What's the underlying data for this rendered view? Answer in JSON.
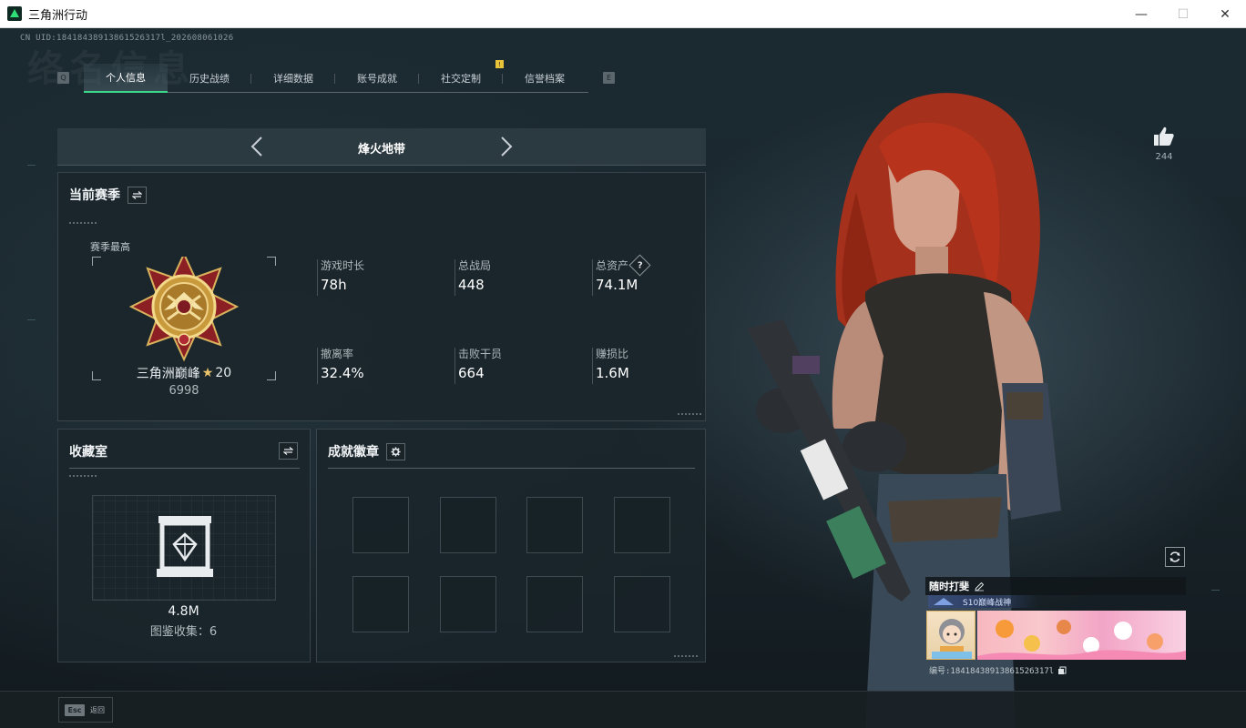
{
  "window": {
    "title": "三角洲行动",
    "minimize": "—",
    "maximize": "☐",
    "close": "✕"
  },
  "header": {
    "uid_line": "CN UID:18418438913861526317l_202608061026",
    "watermark": "络名信息"
  },
  "tabs": {
    "left_key": "Q",
    "right_key": "E",
    "items": [
      {
        "label": "个人信息",
        "active": true
      },
      {
        "label": "历史战绩"
      },
      {
        "label": "详细数据"
      },
      {
        "label": "账号成就"
      },
      {
        "label": "社交定制"
      },
      {
        "label": "信誉档案"
      }
    ],
    "badge": "!"
  },
  "mode": {
    "title": "烽火地带"
  },
  "season": {
    "title": "当前赛季",
    "best_label": "赛季最高",
    "rank_name": "三角洲巅峰",
    "rank_star": "★",
    "rank_level": "20",
    "rank_score": "6998",
    "stats": [
      {
        "label": "游戏时长",
        "value": "78h"
      },
      {
        "label": "总战局",
        "value": "448"
      },
      {
        "label": "总资产",
        "value": "74.1M",
        "help": "?"
      },
      {
        "label": "撤离率",
        "value": "32.4%"
      },
      {
        "label": "击败干员",
        "value": "664"
      },
      {
        "label": "赚损比",
        "value": "1.6M"
      }
    ]
  },
  "collection": {
    "title": "收藏室",
    "value": "4.8M",
    "sub": "图鉴收集：6"
  },
  "achievements": {
    "title": "成就徽章",
    "slot_count": 8
  },
  "like": {
    "count": "244"
  },
  "card": {
    "name": "随时打斐",
    "title_text": "S10巅峰战神",
    "id_line": "编号:18418438913861526317l"
  },
  "bottom": {
    "esc_key": "Esc",
    "esc_label": "返回"
  },
  "colors": {
    "accent": "#39d98a",
    "badge": "#e8c33a",
    "hair": "#b8331c"
  }
}
